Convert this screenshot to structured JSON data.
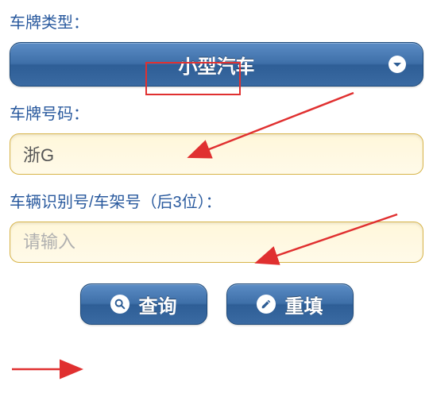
{
  "labels": {
    "plate_type": "车牌类型：",
    "plate_number": "车牌号码：",
    "vin": "车辆识别号/车架号（后3位）："
  },
  "dropdown": {
    "selected": "小型汽车"
  },
  "inputs": {
    "plate_number_value": "浙G",
    "vin_placeholder": "请输入"
  },
  "buttons": {
    "query": "查询",
    "reset": "重填"
  },
  "colors": {
    "primary_button": "#3e6fa8",
    "input_bg": "#fffae9",
    "label_color": "#2a5a9e",
    "annotation_red": "#e03030"
  }
}
